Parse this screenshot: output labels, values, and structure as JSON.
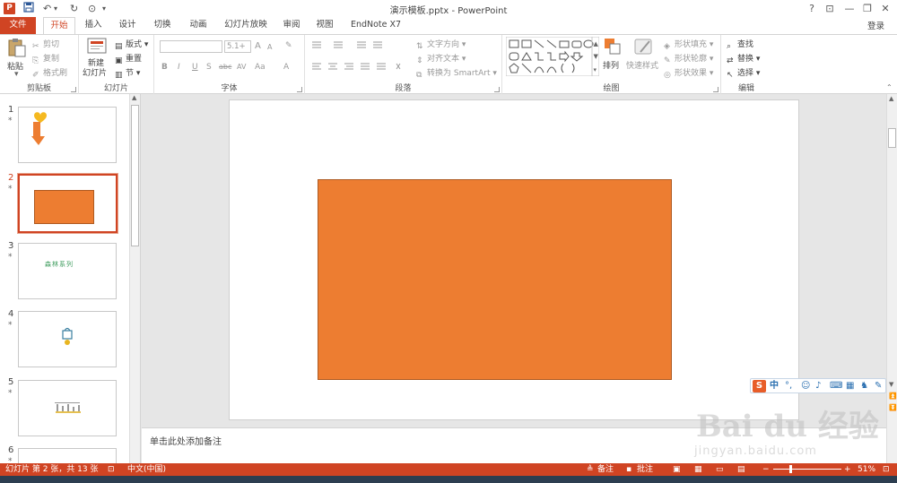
{
  "window": {
    "app_icon": "P",
    "title": "演示模板.pptx - PowerPoint",
    "help": "?",
    "ribbon_display": "⊡",
    "minimize": "—",
    "restore": "❐",
    "close": "✕"
  },
  "quick_access": {
    "save": "💾",
    "undo": "↶",
    "redo": "↻",
    "custom": "⊙"
  },
  "tabs": {
    "file": "文件",
    "items": [
      "开始",
      "插入",
      "设计",
      "切换",
      "动画",
      "幻灯片放映",
      "审阅",
      "视图",
      "EndNote X7"
    ],
    "active": "开始",
    "login": "登录"
  },
  "ribbon": {
    "clipboard": {
      "paste": "粘贴",
      "cut": "剪切",
      "copy": "复制",
      "format_painter": "格式刷",
      "label": "剪贴板"
    },
    "slides": {
      "new_slide_line1": "新建",
      "new_slide_line2": "幻灯片",
      "layout": "版式",
      "reset": "重置",
      "section": "节",
      "label": "幻灯片"
    },
    "font": {
      "font_name": "",
      "font_size": "5.1+",
      "grow": "A",
      "shrink": "A",
      "clear": "✎",
      "bold": "B",
      "italic": "I",
      "underline": "U",
      "shadow": "S",
      "strike": "abc",
      "spacing": "AV",
      "case": "Aa",
      "color": "A",
      "label": "字体"
    },
    "paragraph": {
      "text_direction": "文字方向",
      "align_text": "对齐文本",
      "convert_smartart": "转换为 SmartArt",
      "label": "段落"
    },
    "drawing": {
      "arrange": "排列",
      "quick_styles": "快速样式",
      "shape_fill": "形状填充",
      "shape_outline": "形状轮廓",
      "shape_effects": "形状效果",
      "label": "绘图"
    },
    "editing": {
      "find": "查找",
      "replace": "替换",
      "select": "选择",
      "label": "编辑"
    }
  },
  "thumbnails": [
    {
      "number": "1",
      "star": "*"
    },
    {
      "number": "2",
      "star": "*"
    },
    {
      "number": "3",
      "star": "*",
      "text": "森林系列"
    },
    {
      "number": "4",
      "star": "*"
    },
    {
      "number": "5",
      "star": "*"
    },
    {
      "number": "6",
      "star": "*"
    }
  ],
  "selected_slide": "2",
  "slide": {
    "shape_color": "#ed7d31"
  },
  "notes_placeholder": "单击此处添加备注",
  "ime_bar": {
    "logo": "S",
    "mode": "中",
    "punct": "°,"
  },
  "watermark": {
    "text": "Bai du 经验",
    "url": "jingyan.baidu.com"
  },
  "status": {
    "slide_info": "幻灯片 第 2 张，共 13 张",
    "language": "中文(中国)",
    "notes": "备注",
    "comments": "批注",
    "zoom": "51%"
  },
  "colors": {
    "accent": "#d04423",
    "shape": "#ed7d31"
  }
}
